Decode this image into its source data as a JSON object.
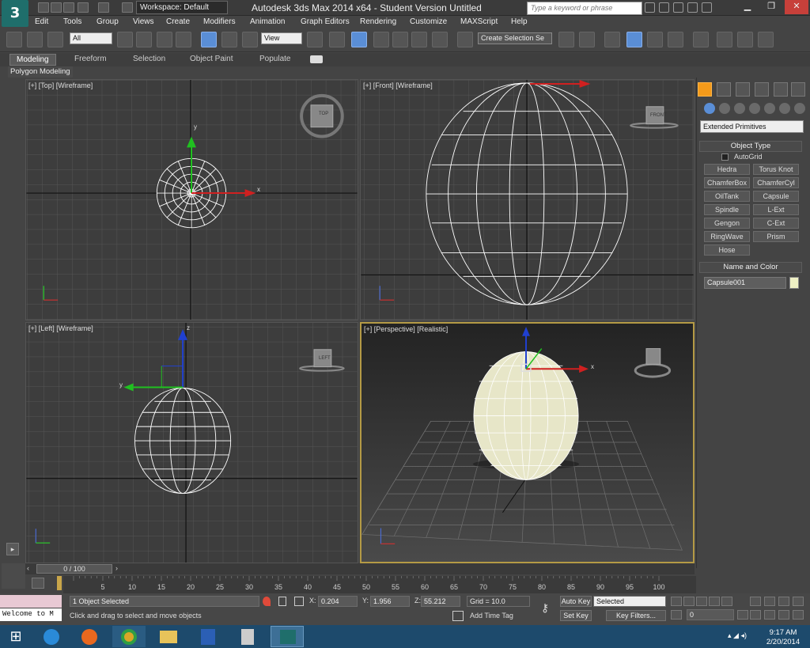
{
  "titlebar": {
    "workspace": "Workspace: Default",
    "title": "Autodesk 3ds Max  2014 x64   -  Student Version    Untitled",
    "search_placeholder": "Type a keyword or phrase"
  },
  "menu": [
    "Edit",
    "Tools",
    "Group",
    "Views",
    "Create",
    "Modifiers",
    "Animation",
    "Graph Editors",
    "Rendering",
    "Customize",
    "MAXScript",
    "Help"
  ],
  "toolbar": {
    "selection_filter": "All",
    "ref_coord": "View",
    "named_selection": "Create Selection Se",
    "angle_snap": "3"
  },
  "ribbon": {
    "tabs": [
      "Modeling",
      "Freeform",
      "Selection",
      "Object Paint",
      "Populate"
    ],
    "sub": "Polygon Modeling"
  },
  "viewports": [
    {
      "label": "[+] [Top] [Wireframe]",
      "cube": "TOP"
    },
    {
      "label": "[+] [Front] [Wireframe]",
      "cube": "FRONT"
    },
    {
      "label": "[+] [Left] [Wireframe]",
      "cube": "LEFT"
    },
    {
      "label": "[+] [Perspective] [Realistic]",
      "cube": ""
    }
  ],
  "axes": {
    "x": "x",
    "y": "y",
    "z": "z"
  },
  "command_panel": {
    "category": "Extended Primitives",
    "object_type_title": "Object Type",
    "autogrid": "AutoGrid",
    "buttons": [
      "Hedra",
      "Torus Knot",
      "ChamferBox",
      "ChamferCyl",
      "OilTank",
      "Capsule",
      "Spindle",
      "L-Ext",
      "Gengon",
      "C-Ext",
      "RingWave",
      "Prism",
      "Hose"
    ],
    "name_color_title": "Name and Color",
    "object_name": "Capsule001",
    "object_color": "#eef0c4"
  },
  "timeline": {
    "position": "0 / 100",
    "frame": 0,
    "frame_count": 100,
    "ticks": [
      "5",
      "10",
      "15",
      "20",
      "25",
      "30",
      "35",
      "40",
      "45",
      "50",
      "55",
      "60",
      "65",
      "70",
      "75",
      "80",
      "85",
      "90",
      "95",
      "100"
    ]
  },
  "status": {
    "maxscript": "Welcome to M",
    "selected": "1 Object Selected",
    "prompt": "Click and drag to select and move objects",
    "x_label": "X:",
    "x": "0.204",
    "y_label": "Y:",
    "y": "1.956",
    "z_label": "Z:",
    "z": "55.212",
    "grid": "Grid = 10.0",
    "add_time_tag": "Add Time Tag",
    "auto_key": "Auto Key",
    "set_key": "Set Key",
    "key_mode": "Selected",
    "key_filters": "Key Filters...",
    "current_frame": "0"
  },
  "taskbar": {
    "time": "9:17 AM",
    "date": "2/20/2014"
  }
}
